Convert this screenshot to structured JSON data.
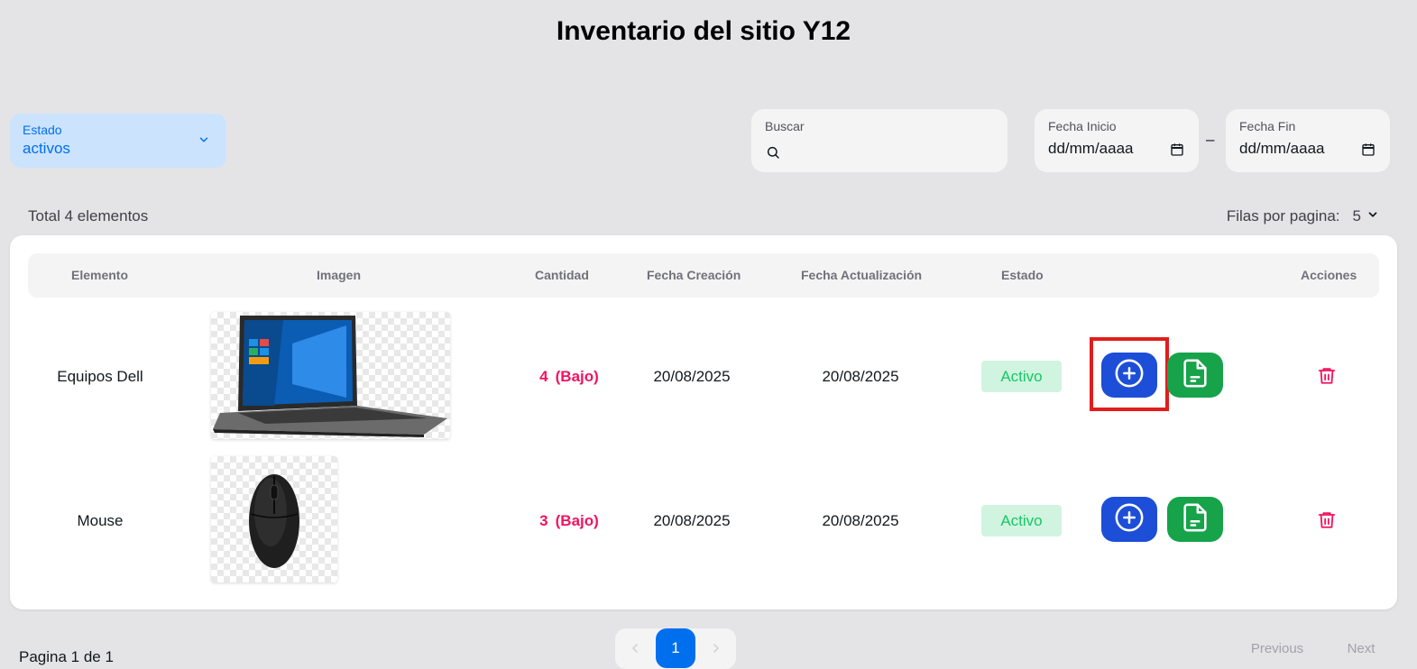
{
  "page": {
    "title": "Inventario del sitio Y12"
  },
  "filters": {
    "estado": {
      "label": "Estado",
      "value": "activos"
    },
    "search": {
      "label": "Buscar",
      "placeholder": ""
    },
    "fecha_inicio": {
      "label": "Fecha Inicio",
      "value": "dd/mm/aaaa"
    },
    "fecha_fin": {
      "label": "Fecha Fin",
      "value": "dd/mm/aaaa"
    },
    "date_separator": "–"
  },
  "summary": {
    "total_label": "Total 4 elementos",
    "rows_per_page_label": "Filas por pagina:",
    "rows_per_page_value": "5"
  },
  "table": {
    "headers": [
      "Elemento",
      "Imagen",
      "Cantidad",
      "Fecha Creación",
      "Fecha Actualización",
      "Estado",
      "Acciones"
    ],
    "rows": [
      {
        "name": "Equipos Dell",
        "image": "laptop",
        "qty": "4",
        "qty_status": "(Bajo)",
        "created": "20/08/2025",
        "updated": "20/08/2025",
        "status": "Activo"
      },
      {
        "name": "Mouse",
        "image": "mouse",
        "qty": "3",
        "qty_status": "(Bajo)",
        "created": "20/08/2025",
        "updated": "20/08/2025",
        "status": "Activo"
      }
    ]
  },
  "icons": {
    "add": "plus-circle-icon",
    "document": "file-text-icon",
    "delete": "trash-icon",
    "search": "search-icon",
    "calendar": "calendar-icon"
  },
  "footer": {
    "page_label": "Pagina 1 de 1",
    "current_page": "1",
    "previous_label": "Previous",
    "next_label": "Next"
  },
  "colors": {
    "primary": "#006fee",
    "danger": "#f31260",
    "success": "#17c964",
    "add_button": "#1d4ed8",
    "doc_button": "#16a34a",
    "highlight": "#e11d1d"
  }
}
